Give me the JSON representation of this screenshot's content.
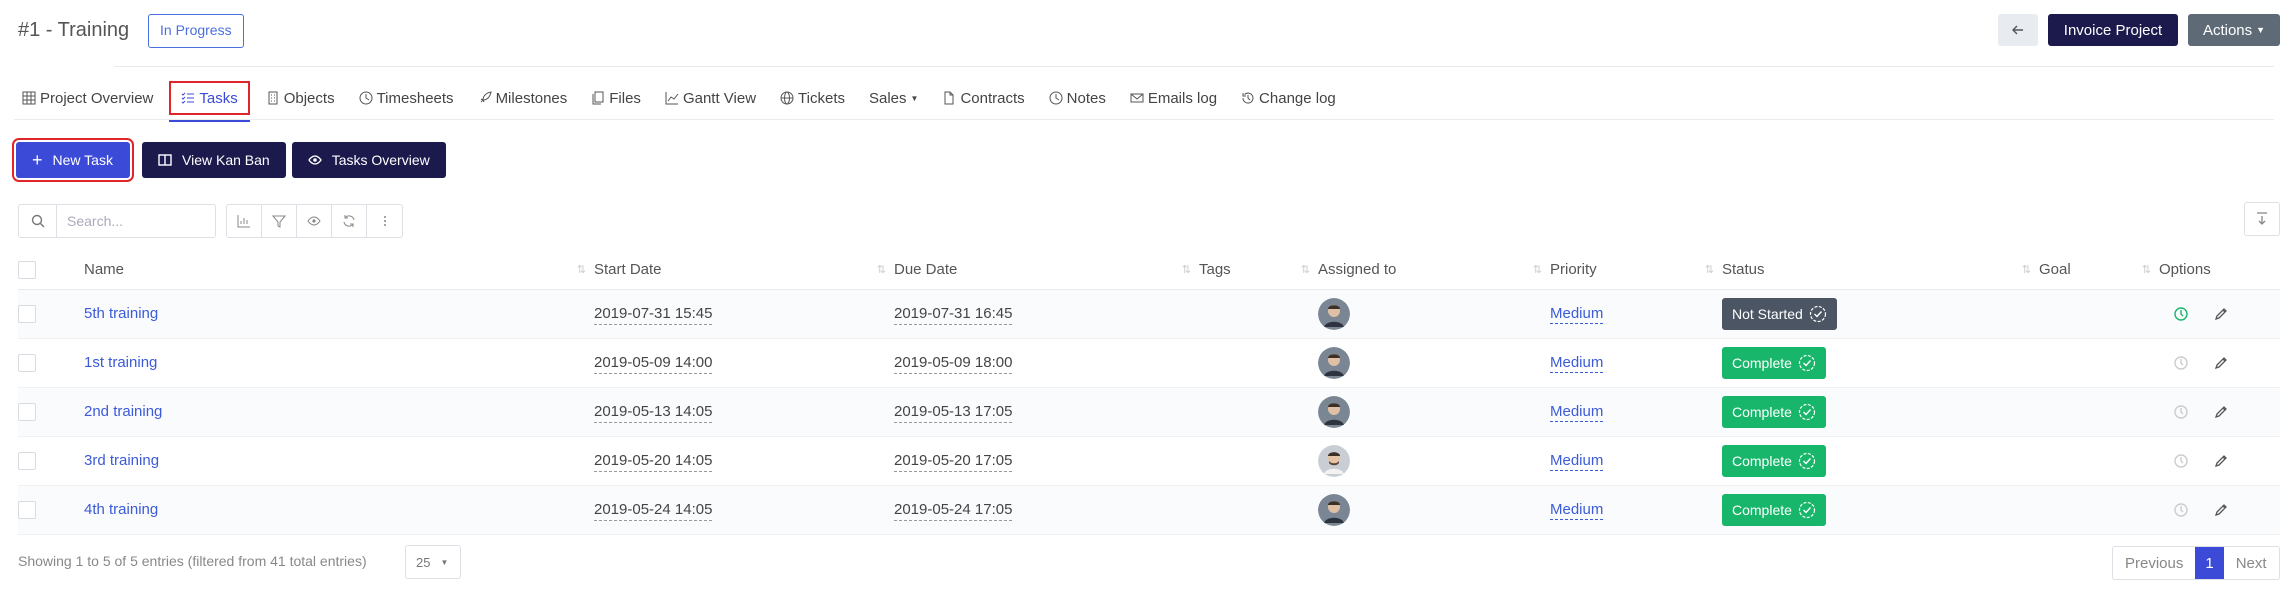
{
  "header": {
    "title": "#1 - Training",
    "status": "In Progress",
    "invoice_label": "Invoice Project",
    "actions_label": "Actions"
  },
  "tabs": [
    {
      "label": "Project Overview",
      "icon": "grid-icon"
    },
    {
      "label": "Tasks",
      "icon": "list-check-icon"
    },
    {
      "label": "Objects",
      "icon": "building-icon"
    },
    {
      "label": "Timesheets",
      "icon": "clock-icon"
    },
    {
      "label": "Milestones",
      "icon": "rocket-icon"
    },
    {
      "label": "Files",
      "icon": "files-icon"
    },
    {
      "label": "Gantt View",
      "icon": "chart-line-icon"
    },
    {
      "label": "Tickets",
      "icon": "globe-icon"
    },
    {
      "label": "Sales",
      "icon": "caret-down-icon"
    },
    {
      "label": "Contracts",
      "icon": "file-icon"
    },
    {
      "label": "Notes",
      "icon": "clock-icon"
    },
    {
      "label": "Emails log",
      "icon": "envelope-icon"
    },
    {
      "label": "Change log",
      "icon": "history-icon"
    }
  ],
  "toolbar": {
    "new_task": "New Task",
    "view_kanban": "View Kan Ban",
    "tasks_overview": "Tasks Overview"
  },
  "search": {
    "placeholder": "Search..."
  },
  "table": {
    "columns": [
      "Name",
      "Start Date",
      "Due Date",
      "Tags",
      "Assigned to",
      "Priority",
      "Status",
      "Goal",
      "Options"
    ],
    "rows": [
      {
        "name": "5th training",
        "start": "2019-07-31 15:45",
        "due": "2019-07-31 16:45",
        "priority": "Medium",
        "status": "Not Started"
      },
      {
        "name": "1st training",
        "start": "2019-05-09 14:00",
        "due": "2019-05-09 18:00",
        "priority": "Medium",
        "status": "Complete"
      },
      {
        "name": "2nd training",
        "start": "2019-05-13 14:05",
        "due": "2019-05-13 17:05",
        "priority": "Medium",
        "status": "Complete"
      },
      {
        "name": "3rd training",
        "start": "2019-05-20 14:05",
        "due": "2019-05-20 17:05",
        "priority": "Medium",
        "status": "Complete"
      },
      {
        "name": "4th training",
        "start": "2019-05-24 14:05",
        "due": "2019-05-24 17:05",
        "priority": "Medium",
        "status": "Complete"
      }
    ]
  },
  "footer": {
    "info": "Showing 1 to 5 of 5 entries (filtered from 41 total entries)",
    "page_length": "25",
    "prev": "Previous",
    "current_page": "1",
    "next": "Next"
  },
  "colors": {
    "accent": "#3b4bd8",
    "dark": "#1c1a4d",
    "complete": "#18b66a",
    "not_started": "#4b5563",
    "highlight": "#e0252d"
  }
}
